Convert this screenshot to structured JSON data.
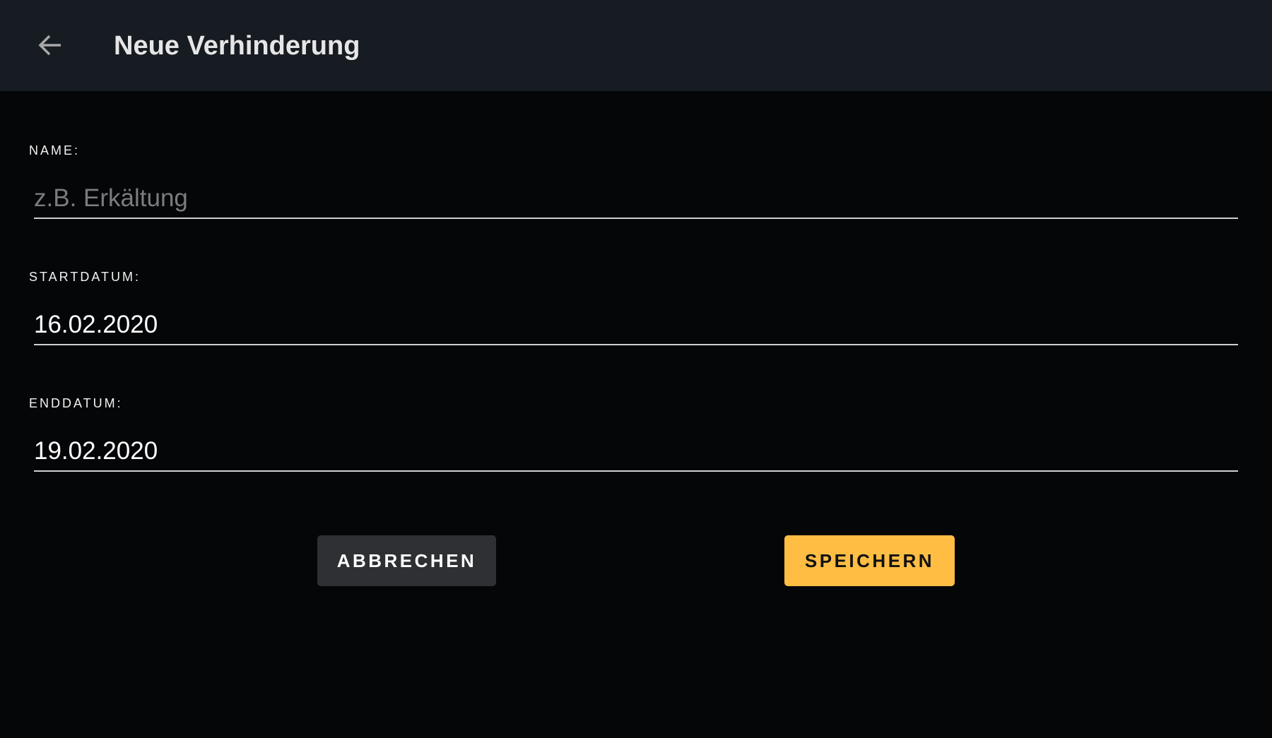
{
  "header": {
    "title": "Neue Verhinderung",
    "back_icon": "arrow-left-icon"
  },
  "form": {
    "name": {
      "label": "NAME:",
      "value": "",
      "placeholder": "z.B. Erkältung"
    },
    "start": {
      "label": "STARTDATUM:",
      "value": "16.02.2020"
    },
    "end": {
      "label": "ENDDATUM:",
      "value": "19.02.2020"
    }
  },
  "actions": {
    "cancel_label": "ABBRECHEN",
    "save_label": "SPEICHERN"
  },
  "colors": {
    "accent": "#ffbd44",
    "header_bg": "#171b22",
    "background": "#050608"
  }
}
